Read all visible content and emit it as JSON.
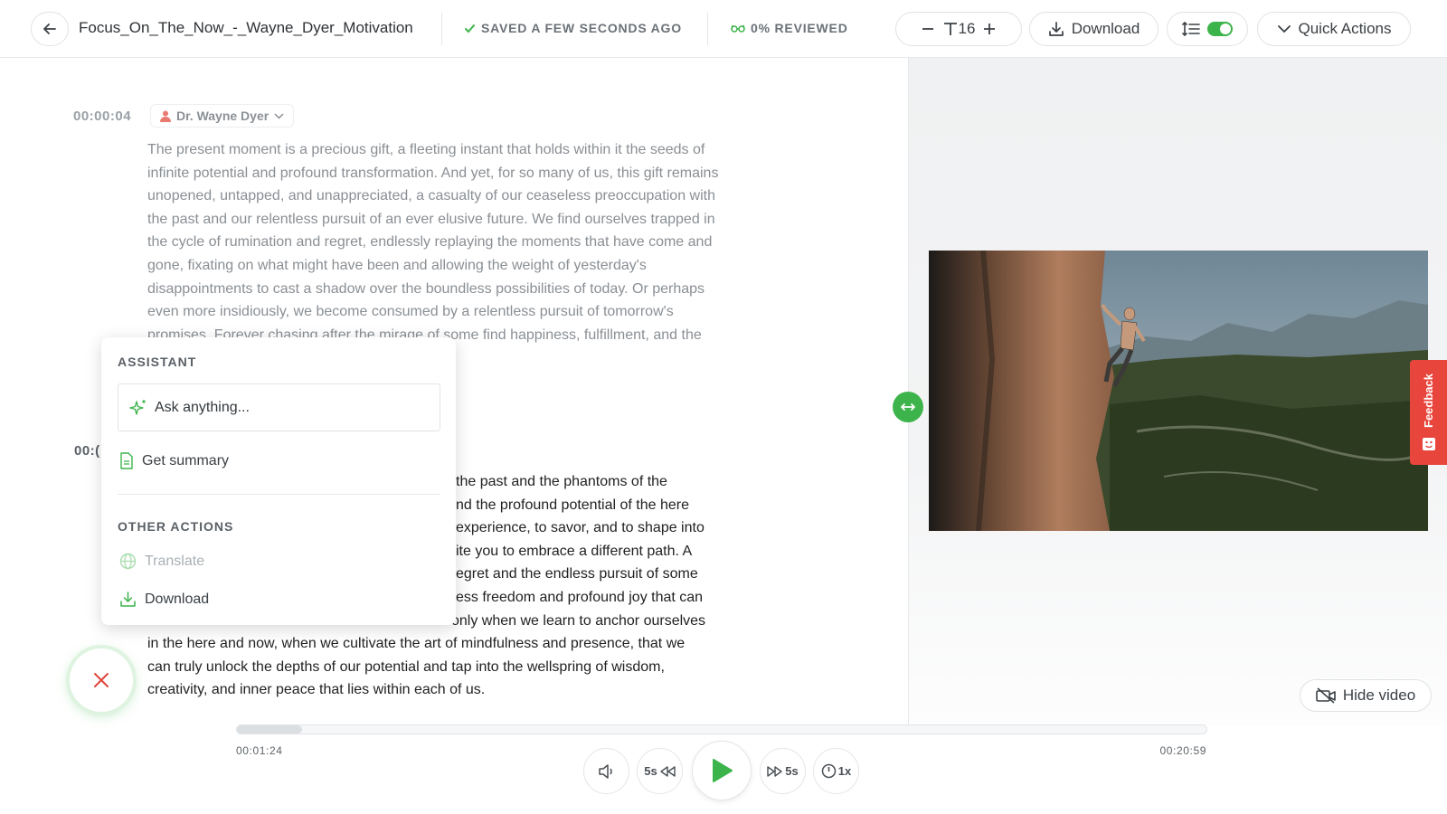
{
  "header": {
    "file_name": "Focus_On_The_Now_-_Wayne_Dyer_Motivation",
    "saved_status": "SAVED A FEW SECONDS AGO",
    "reviewed_status": "0% REVIEWED",
    "font_size": "16",
    "download_label": "Download",
    "quick_actions_label": "Quick Actions"
  },
  "transcript": {
    "segments": [
      {
        "time": "00:00:04",
        "speaker": "Dr. Wayne Dyer",
        "text": "The present moment is a precious gift, a fleeting instant that holds within it the seeds of infinite potential and profound transformation. And yet, for so many of us, this gift remains unopened, untapped, and unappreciated, a casualty of our ceaseless preoccupation with the past and our relentless pursuit of an ever elusive future. We find ourselves trapped in the cycle of rumination and regret, endlessly replaying the moments that have come and gone, fixating on what might have been and allowing the weight of yesterday's disappointments to cast a shadow over the boundless possibilities of today. Or perhaps even more insidiously, we become consumed by a relentless pursuit of tomorrow's promises. Forever chasing after the mirage of some find happiness, fulfillment, and the ude us in the present."
      },
      {
        "time": "00:(",
        "text_lines": [
          "the past and the phantoms of the",
          "nd the profound potential of the here",
          "experience, to savor, and to shape into",
          "ite you to embrace a different path. A",
          "egret and the endless pursuit of some",
          "ess freedom and profound joy that can",
          "only when we learn to anchor ourselves",
          "in the here and now, when we cultivate the art of mindfulness and presence, that we",
          "can truly unlock the depths of our potential and tap into the wellspring of wisdom,",
          "creativity, and inner peace that lies within each of us."
        ]
      }
    ]
  },
  "assistant": {
    "title": "ASSISTANT",
    "ask_placeholder": "Ask anything...",
    "get_summary": "Get summary",
    "other_actions_title": "OTHER ACTIONS",
    "translate": "Translate",
    "download": "Download"
  },
  "video_panel": {
    "feedback_label": "Feedback",
    "hide_video_label": "Hide video"
  },
  "player": {
    "current_time": "00:01:24",
    "total_time": "00:20:59",
    "progress_fraction": 0.0667,
    "rewind_label": "5s",
    "forward_label": "5s",
    "speed_label": "1x"
  },
  "colors": {
    "accent_green": "#3cb44b",
    "feedback_red": "#e8453c",
    "close_red": "#e0463c"
  }
}
